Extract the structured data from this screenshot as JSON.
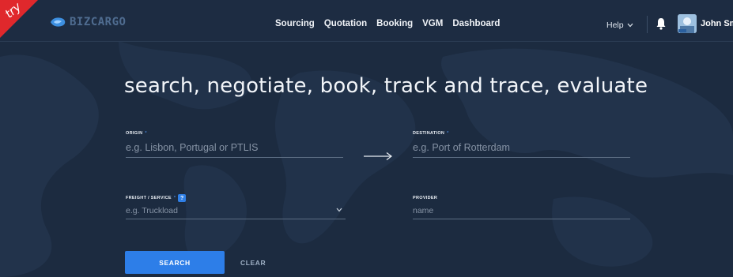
{
  "brand": {
    "ribbon_text": "try",
    "logo_text": "BIZCARGO",
    "logo_icon": "bizcargo-logo-icon",
    "ribbon_color": "#e0282c",
    "accent_color": "#2d7ee8"
  },
  "nav": {
    "items": [
      {
        "label": "Sourcing"
      },
      {
        "label": "Quotation"
      },
      {
        "label": "Booking"
      },
      {
        "label": "VGM"
      },
      {
        "label": "Dashboard"
      }
    ]
  },
  "user_bar": {
    "help_label": "Help",
    "help_icon": "chevron-down-icon",
    "notification_icon": "bell-icon",
    "user_name": "John Smit"
  },
  "hero": {
    "title": "search, negotiate, book, track and trace, evaluate"
  },
  "form": {
    "origin": {
      "label": "ORIGIN",
      "required_mark": "*",
      "placeholder": "e.g. Lisbon, Portugal or PTLIS",
      "value": ""
    },
    "destination": {
      "label": "DESTINATION",
      "required_mark": "*",
      "placeholder": "e.g. Port of Rotterdam",
      "value": ""
    },
    "route_icon": "arrow-right-icon",
    "freight": {
      "label": "FREIGHT / SERVICE",
      "required_mark": "*",
      "help_badge": "?",
      "placeholder": "e.g. Truckload",
      "value": ""
    },
    "provider": {
      "label": "PROVIDER",
      "placeholder": "name",
      "value": ""
    },
    "search_label": "SEARCH",
    "clear_label": "CLEAR"
  }
}
